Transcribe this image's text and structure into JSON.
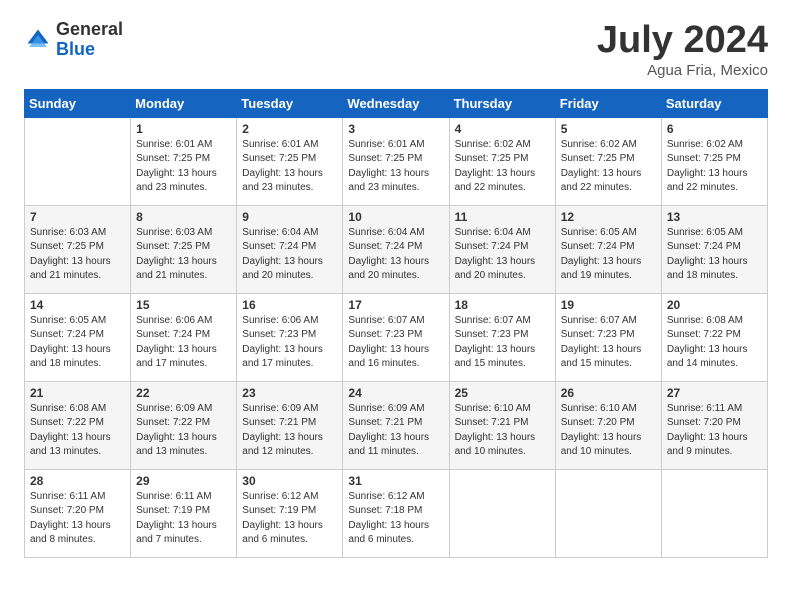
{
  "logo": {
    "general": "General",
    "blue": "Blue"
  },
  "title": "July 2024",
  "location": "Agua Fria, Mexico",
  "days_of_week": [
    "Sunday",
    "Monday",
    "Tuesday",
    "Wednesday",
    "Thursday",
    "Friday",
    "Saturday"
  ],
  "weeks": [
    [
      {
        "num": "",
        "sunrise": "",
        "sunset": "",
        "daylight": ""
      },
      {
        "num": "1",
        "sunrise": "Sunrise: 6:01 AM",
        "sunset": "Sunset: 7:25 PM",
        "daylight": "Daylight: 13 hours and 23 minutes."
      },
      {
        "num": "2",
        "sunrise": "Sunrise: 6:01 AM",
        "sunset": "Sunset: 7:25 PM",
        "daylight": "Daylight: 13 hours and 23 minutes."
      },
      {
        "num": "3",
        "sunrise": "Sunrise: 6:01 AM",
        "sunset": "Sunset: 7:25 PM",
        "daylight": "Daylight: 13 hours and 23 minutes."
      },
      {
        "num": "4",
        "sunrise": "Sunrise: 6:02 AM",
        "sunset": "Sunset: 7:25 PM",
        "daylight": "Daylight: 13 hours and 22 minutes."
      },
      {
        "num": "5",
        "sunrise": "Sunrise: 6:02 AM",
        "sunset": "Sunset: 7:25 PM",
        "daylight": "Daylight: 13 hours and 22 minutes."
      },
      {
        "num": "6",
        "sunrise": "Sunrise: 6:02 AM",
        "sunset": "Sunset: 7:25 PM",
        "daylight": "Daylight: 13 hours and 22 minutes."
      }
    ],
    [
      {
        "num": "7",
        "sunrise": "Sunrise: 6:03 AM",
        "sunset": "Sunset: 7:25 PM",
        "daylight": "Daylight: 13 hours and 21 minutes."
      },
      {
        "num": "8",
        "sunrise": "Sunrise: 6:03 AM",
        "sunset": "Sunset: 7:25 PM",
        "daylight": "Daylight: 13 hours and 21 minutes."
      },
      {
        "num": "9",
        "sunrise": "Sunrise: 6:04 AM",
        "sunset": "Sunset: 7:24 PM",
        "daylight": "Daylight: 13 hours and 20 minutes."
      },
      {
        "num": "10",
        "sunrise": "Sunrise: 6:04 AM",
        "sunset": "Sunset: 7:24 PM",
        "daylight": "Daylight: 13 hours and 20 minutes."
      },
      {
        "num": "11",
        "sunrise": "Sunrise: 6:04 AM",
        "sunset": "Sunset: 7:24 PM",
        "daylight": "Daylight: 13 hours and 20 minutes."
      },
      {
        "num": "12",
        "sunrise": "Sunrise: 6:05 AM",
        "sunset": "Sunset: 7:24 PM",
        "daylight": "Daylight: 13 hours and 19 minutes."
      },
      {
        "num": "13",
        "sunrise": "Sunrise: 6:05 AM",
        "sunset": "Sunset: 7:24 PM",
        "daylight": "Daylight: 13 hours and 18 minutes."
      }
    ],
    [
      {
        "num": "14",
        "sunrise": "Sunrise: 6:05 AM",
        "sunset": "Sunset: 7:24 PM",
        "daylight": "Daylight: 13 hours and 18 minutes."
      },
      {
        "num": "15",
        "sunrise": "Sunrise: 6:06 AM",
        "sunset": "Sunset: 7:24 PM",
        "daylight": "Daylight: 13 hours and 17 minutes."
      },
      {
        "num": "16",
        "sunrise": "Sunrise: 6:06 AM",
        "sunset": "Sunset: 7:23 PM",
        "daylight": "Daylight: 13 hours and 17 minutes."
      },
      {
        "num": "17",
        "sunrise": "Sunrise: 6:07 AM",
        "sunset": "Sunset: 7:23 PM",
        "daylight": "Daylight: 13 hours and 16 minutes."
      },
      {
        "num": "18",
        "sunrise": "Sunrise: 6:07 AM",
        "sunset": "Sunset: 7:23 PM",
        "daylight": "Daylight: 13 hours and 15 minutes."
      },
      {
        "num": "19",
        "sunrise": "Sunrise: 6:07 AM",
        "sunset": "Sunset: 7:23 PM",
        "daylight": "Daylight: 13 hours and 15 minutes."
      },
      {
        "num": "20",
        "sunrise": "Sunrise: 6:08 AM",
        "sunset": "Sunset: 7:22 PM",
        "daylight": "Daylight: 13 hours and 14 minutes."
      }
    ],
    [
      {
        "num": "21",
        "sunrise": "Sunrise: 6:08 AM",
        "sunset": "Sunset: 7:22 PM",
        "daylight": "Daylight: 13 hours and 13 minutes."
      },
      {
        "num": "22",
        "sunrise": "Sunrise: 6:09 AM",
        "sunset": "Sunset: 7:22 PM",
        "daylight": "Daylight: 13 hours and 13 minutes."
      },
      {
        "num": "23",
        "sunrise": "Sunrise: 6:09 AM",
        "sunset": "Sunset: 7:21 PM",
        "daylight": "Daylight: 13 hours and 12 minutes."
      },
      {
        "num": "24",
        "sunrise": "Sunrise: 6:09 AM",
        "sunset": "Sunset: 7:21 PM",
        "daylight": "Daylight: 13 hours and 11 minutes."
      },
      {
        "num": "25",
        "sunrise": "Sunrise: 6:10 AM",
        "sunset": "Sunset: 7:21 PM",
        "daylight": "Daylight: 13 hours and 10 minutes."
      },
      {
        "num": "26",
        "sunrise": "Sunrise: 6:10 AM",
        "sunset": "Sunset: 7:20 PM",
        "daylight": "Daylight: 13 hours and 10 minutes."
      },
      {
        "num": "27",
        "sunrise": "Sunrise: 6:11 AM",
        "sunset": "Sunset: 7:20 PM",
        "daylight": "Daylight: 13 hours and 9 minutes."
      }
    ],
    [
      {
        "num": "28",
        "sunrise": "Sunrise: 6:11 AM",
        "sunset": "Sunset: 7:20 PM",
        "daylight": "Daylight: 13 hours and 8 minutes."
      },
      {
        "num": "29",
        "sunrise": "Sunrise: 6:11 AM",
        "sunset": "Sunset: 7:19 PM",
        "daylight": "Daylight: 13 hours and 7 minutes."
      },
      {
        "num": "30",
        "sunrise": "Sunrise: 6:12 AM",
        "sunset": "Sunset: 7:19 PM",
        "daylight": "Daylight: 13 hours and 6 minutes."
      },
      {
        "num": "31",
        "sunrise": "Sunrise: 6:12 AM",
        "sunset": "Sunset: 7:18 PM",
        "daylight": "Daylight: 13 hours and 6 minutes."
      },
      {
        "num": "",
        "sunrise": "",
        "sunset": "",
        "daylight": ""
      },
      {
        "num": "",
        "sunrise": "",
        "sunset": "",
        "daylight": ""
      },
      {
        "num": "",
        "sunrise": "",
        "sunset": "",
        "daylight": ""
      }
    ]
  ]
}
